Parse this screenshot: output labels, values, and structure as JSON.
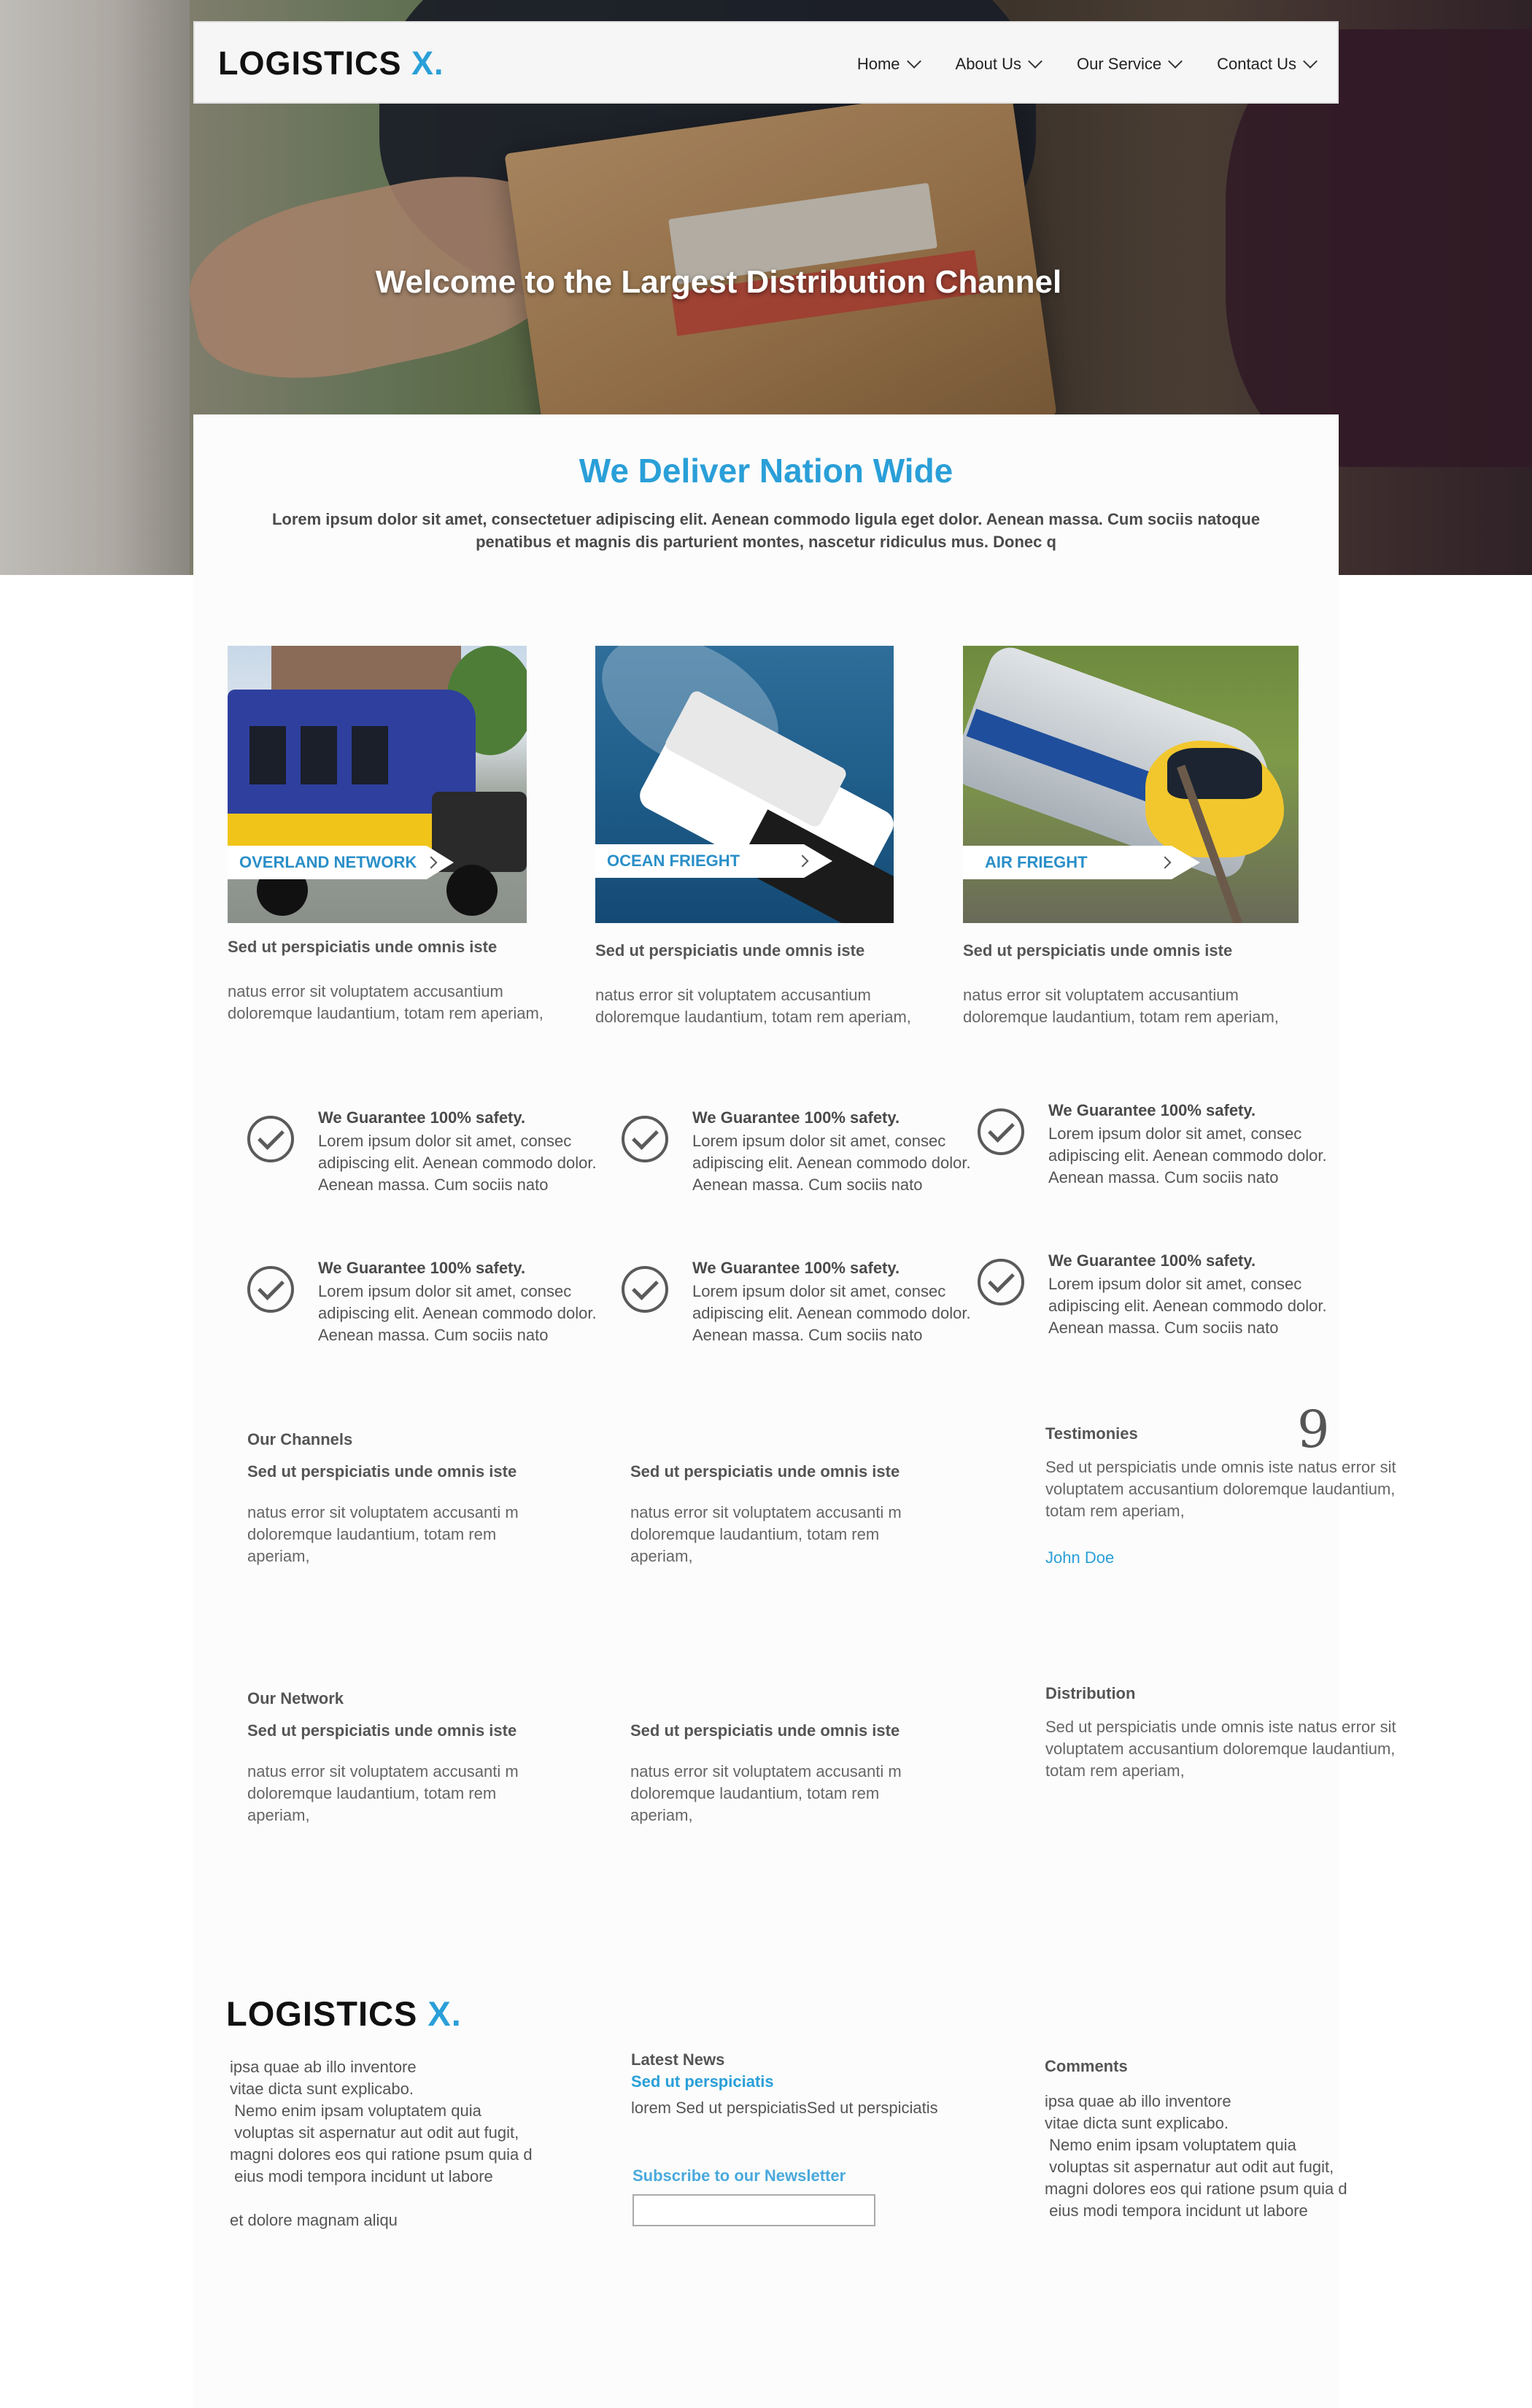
{
  "brand": {
    "name": "LOGISTICS",
    "mark": "X.",
    "accent": "#2a9fd8"
  },
  "nav": {
    "items": [
      {
        "label": "Home"
      },
      {
        "label": "About Us"
      },
      {
        "label": "Our Service"
      },
      {
        "label": "Contact Us"
      }
    ]
  },
  "hero": {
    "title": "Welcome to the Largest Distribution Channel"
  },
  "intro": {
    "title": "We Deliver  Nation Wide",
    "text": "Lorem ipsum dolor sit amet, consectetuer adipiscing elit. Aenean commodo ligula eget dolor. Aenean massa. Cum sociis natoque penatibus et magnis dis parturient montes, nascetur ridiculus mus. Donec q"
  },
  "services": [
    {
      "tag": "OVERLAND NETWORK",
      "heading": "Sed ut perspiciatis unde omnis iste",
      "text": "natus error sit voluptatem accusantium doloremque laudantium, totam rem aperiam,"
    },
    {
      "tag": "OCEAN FRIEGHT",
      "heading": "Sed ut perspiciatis unde omnis iste",
      "text": "natus error sit voluptatem accusantium doloremque laudantium, totam rem aperiam,"
    },
    {
      "tag": "AIR FRIEGHT",
      "heading": "Sed ut perspiciatis unde omnis iste",
      "text": "natus error sit voluptatem accusantium doloremque laudantium, totam rem aperiam,"
    }
  ],
  "guarantees": [
    {
      "title": "We Guarantee 100% safety.",
      "text": "Lorem ipsum dolor sit amet, consec adipiscing elit. Aenean commodo dolor. Aenean massa. Cum sociis nato"
    },
    {
      "title": "We Guarantee 100% safety.",
      "text": "Lorem ipsum dolor sit amet, consec adipiscing elit. Aenean commodo dolor. Aenean massa. Cum sociis nato"
    },
    {
      "title": "We Guarantee 100% safety.",
      "text": "Lorem ipsum dolor sit amet, consec adipiscing elit. Aenean commodo dolor. Aenean massa. Cum sociis nato"
    },
    {
      "title": "We Guarantee 100% safety.",
      "text": "Lorem ipsum dolor sit amet, consec adipiscing elit. Aenean commodo dolor. Aenean massa. Cum sociis nato"
    },
    {
      "title": "We Guarantee 100% safety.",
      "text": "Lorem ipsum dolor sit amet, consec adipiscing elit. Aenean commodo dolor. Aenean massa. Cum sociis nato"
    },
    {
      "title": "We Guarantee 100% safety.",
      "text": "Lorem ipsum dolor sit amet, consec adipiscing elit. Aenean commodo dolor. Aenean massa. Cum sociis nato"
    }
  ],
  "channels": {
    "title": "Our Channels",
    "cols": [
      {
        "heading": "Sed ut perspiciatis unde omnis iste",
        "text": "natus error sit voluptatem accusanti m doloremque laudantium, totam rem aperiam,"
      },
      {
        "heading": "Sed ut perspiciatis unde omnis iste",
        "text": "natus error sit voluptatem accusanti m doloremque laudantium, totam rem aperiam,"
      }
    ]
  },
  "network": {
    "title": "Our Network",
    "cols": [
      {
        "heading": "Sed ut perspiciatis unde omnis iste",
        "text": "natus error sit voluptatem accusanti m doloremque laudantium, totam rem aperiam,"
      },
      {
        "heading": "Sed ut perspiciatis unde omnis iste",
        "text": "natus error sit voluptatem accusanti m doloremque laudantium, totam rem aperiam,"
      }
    ]
  },
  "testimonies": {
    "title": "Testimonies",
    "text": "Sed ut perspiciatis unde omnis iste natus error sit voluptatem accusantium doloremque laudantium, totam rem aperiam,",
    "author": "John Doe"
  },
  "distribution": {
    "title": "Distribution",
    "text": "Sed ut perspiciatis unde omnis iste natus error sit voluptatem accusantium doloremque laudantium, totam rem aperiam,"
  },
  "footer": {
    "about_lines": [
      "ipsa quae ab illo inventore",
      "vitae dicta sunt explicabo.",
      " Nemo enim ipsam voluptatem quia",
      " voluptas sit aspernatur aut odit aut fugit,",
      "magni dolores eos qui ratione psum quia d",
      " eius modi tempora incidunt ut labore"
    ],
    "about_tail": "et dolore magnam aliqu",
    "news_title": "Latest News",
    "news_link": "Sed ut perspiciatis",
    "news_text": "lorem Sed ut perspiciatisSed ut perspiciatis",
    "newsletter_label": "Subscribe to our Newsletter",
    "newsletter_value": "",
    "comments_title": "Comments",
    "comments_lines": [
      "ipsa quae ab illo inventore",
      "vitae dicta sunt explicabo.",
      " Nemo enim ipsam voluptatem quia",
      " voluptas sit aspernatur aut odit aut fugit,",
      "magni dolores eos qui ratione psum quia d",
      " eius modi tempora incidunt ut labore"
    ]
  }
}
